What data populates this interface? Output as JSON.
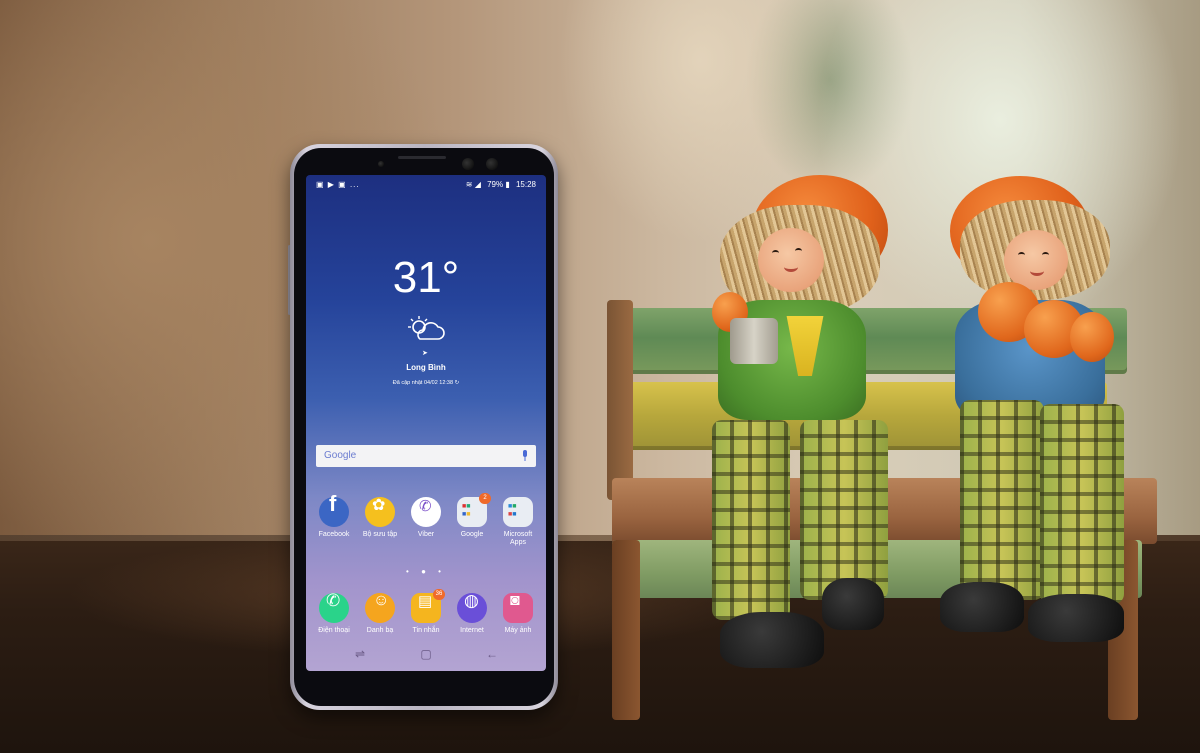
{
  "scene": {
    "description_free": true
  },
  "phone": {
    "status_bar": {
      "left_icons": [
        "messenger-icon",
        "youtube-icon",
        "more-icon"
      ],
      "left_text": "▣ ▶ ▣ ...",
      "right_icons_text": "≋ ◢",
      "battery": "79%",
      "time": "15:28"
    },
    "weather": {
      "temperature": "31°",
      "location": "Long Bình",
      "updated": "Đã cập nhật 04/02 12:38"
    },
    "search": {
      "logo": "Google"
    },
    "apps_row1": [
      {
        "label": "Facebook",
        "icon": "facebook-icon",
        "color": "#3b66c4"
      },
      {
        "label": "Bộ sưu tập",
        "icon": "gallery-icon",
        "color": "#f5c01e"
      },
      {
        "label": "Viber",
        "icon": "viber-icon",
        "color": "#ffffff"
      },
      {
        "label": "Google",
        "icon": "google-folder-icon",
        "color": "#e9edf3",
        "badge": "2"
      },
      {
        "label": "Microsoft Apps",
        "icon": "microsoft-folder-icon",
        "color": "#e9edf3"
      }
    ],
    "page_dots": "• ● •",
    "apps_row2": [
      {
        "label": "Điện thoại",
        "icon": "phone-icon",
        "color": "#2ad38a"
      },
      {
        "label": "Danh bạ",
        "icon": "contacts-icon",
        "color": "#f5a51e"
      },
      {
        "label": "Tin nhắn",
        "icon": "messages-icon",
        "color": "#f5b51e",
        "badge": "36"
      },
      {
        "label": "Internet",
        "icon": "internet-icon",
        "color": "#6a4fd8"
      },
      {
        "label": "Máy ảnh",
        "icon": "camera-icon",
        "color": "#e0598f"
      }
    ],
    "nav": {
      "recent": "⇌",
      "home": "▢",
      "back": "←"
    }
  }
}
